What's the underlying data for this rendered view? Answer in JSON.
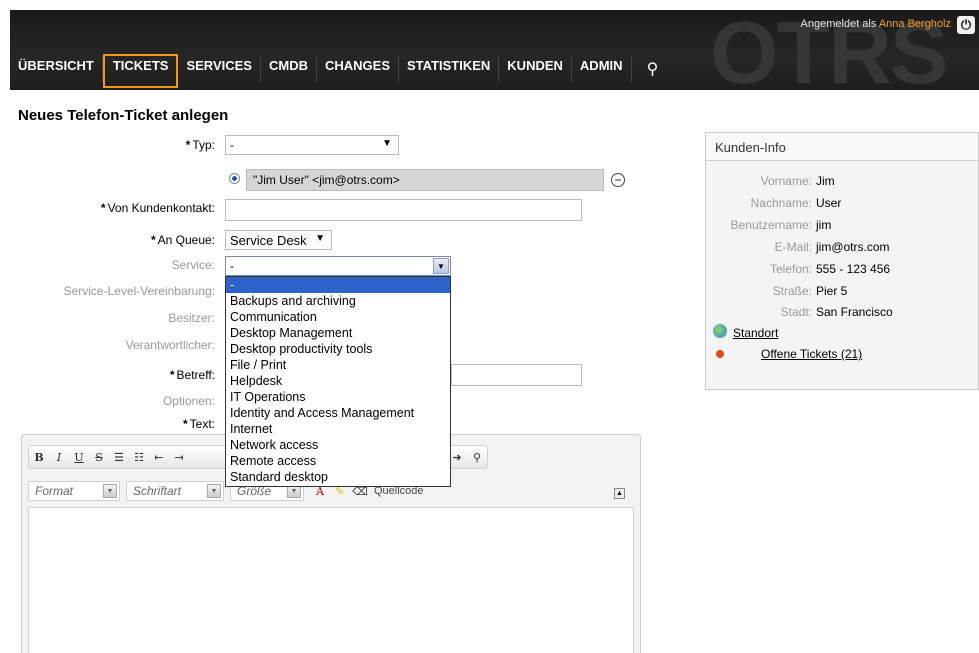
{
  "header": {
    "logo_text": "OTRS",
    "logged_in_prefix": "Angemeldet als",
    "user_name": "Anna Bergholz",
    "nav": [
      "ÜBERSICHT",
      "TICKETS",
      "SERVICES",
      "CMDB",
      "CHANGES",
      "STATISTIKEN",
      "KUNDEN",
      "ADMIN"
    ],
    "active_nav": "TICKETS"
  },
  "page_title": "Neues Telefon-Ticket anlegen",
  "form": {
    "type_label": "Typ:",
    "type_value": "-",
    "customer_chip": "\"Jim User\" <jim@otrs.com>",
    "from_customer_label": "Von Kundenkontakt:",
    "queue_label": "An Queue:",
    "queue_value": "Service Desk",
    "service_label": "Service:",
    "service_value": "-",
    "sla_label": "Service-Level-Vereinbarung:",
    "owner_label": "Besitzer:",
    "responsible_label": "Verantwortlicher:",
    "subject_label": "Betreff:",
    "options_label": "Optionen:",
    "text_label": "Text:"
  },
  "service_options": [
    "-",
    "Backups and archiving",
    "Communication",
    "Desktop Management",
    "Desktop productivity tools",
    "File / Print",
    "Helpdesk",
    "IT Operations",
    "Identity and Access Management",
    "Internet",
    "Network access",
    "Remote access",
    "Standard desktop"
  ],
  "editor": {
    "format_label": "Format",
    "font_label": "Schriftart",
    "size_label": "Größe",
    "source_label": "Quellcode"
  },
  "customer_info": {
    "title": "Kunden-Info",
    "rows": [
      {
        "k": "Vorname:",
        "v": "Jim"
      },
      {
        "k": "Nachname:",
        "v": "User"
      },
      {
        "k": "Benutzername:",
        "v": "jim"
      },
      {
        "k": "E-Mail:",
        "v": "jim@otrs.com"
      },
      {
        "k": "Telefon:",
        "v": "555 - 123 456"
      },
      {
        "k": "Straße:",
        "v": "Pier 5"
      },
      {
        "k": "Stadt:",
        "v": "San Francisco"
      }
    ],
    "location_link": "Standort",
    "open_tickets_link": "Offene Tickets (21)"
  },
  "colors": {
    "accent": "#f7941d",
    "selection": "#2d62c8",
    "header_bg": "#1e1e1e"
  }
}
